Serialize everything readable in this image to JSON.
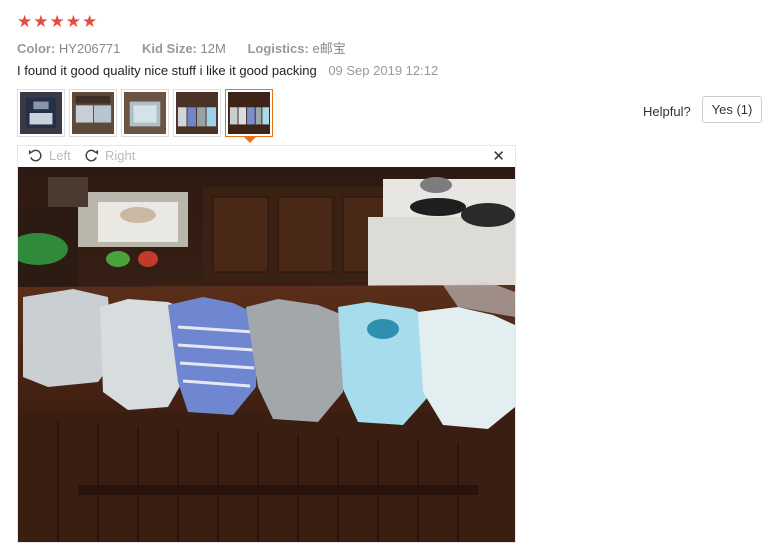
{
  "rating": {
    "stars": 5,
    "color": "#e74c3c",
    "glyph": "★"
  },
  "attributes": {
    "color_label": "Color:",
    "color_value": "HY206771",
    "size_label": "Kid Size:",
    "size_value": "12M",
    "logistics_label": "Logistics:",
    "logistics_value": "e邮宝"
  },
  "review": {
    "text": "I found it good quality nice stuff i like it good packing",
    "date": "09 Sep 2019 12:12"
  },
  "thumbnails": {
    "count": 5,
    "active_index": 4,
    "active_color": "#e5731a"
  },
  "helpful": {
    "label": "Helpful?",
    "button": "Yes (1)"
  },
  "viewer": {
    "rotate_left": "Left",
    "rotate_right": "Right",
    "close_glyph": "✕",
    "icons": [
      "rotate-left-icon",
      "rotate-right-icon",
      "close-icon"
    ]
  }
}
